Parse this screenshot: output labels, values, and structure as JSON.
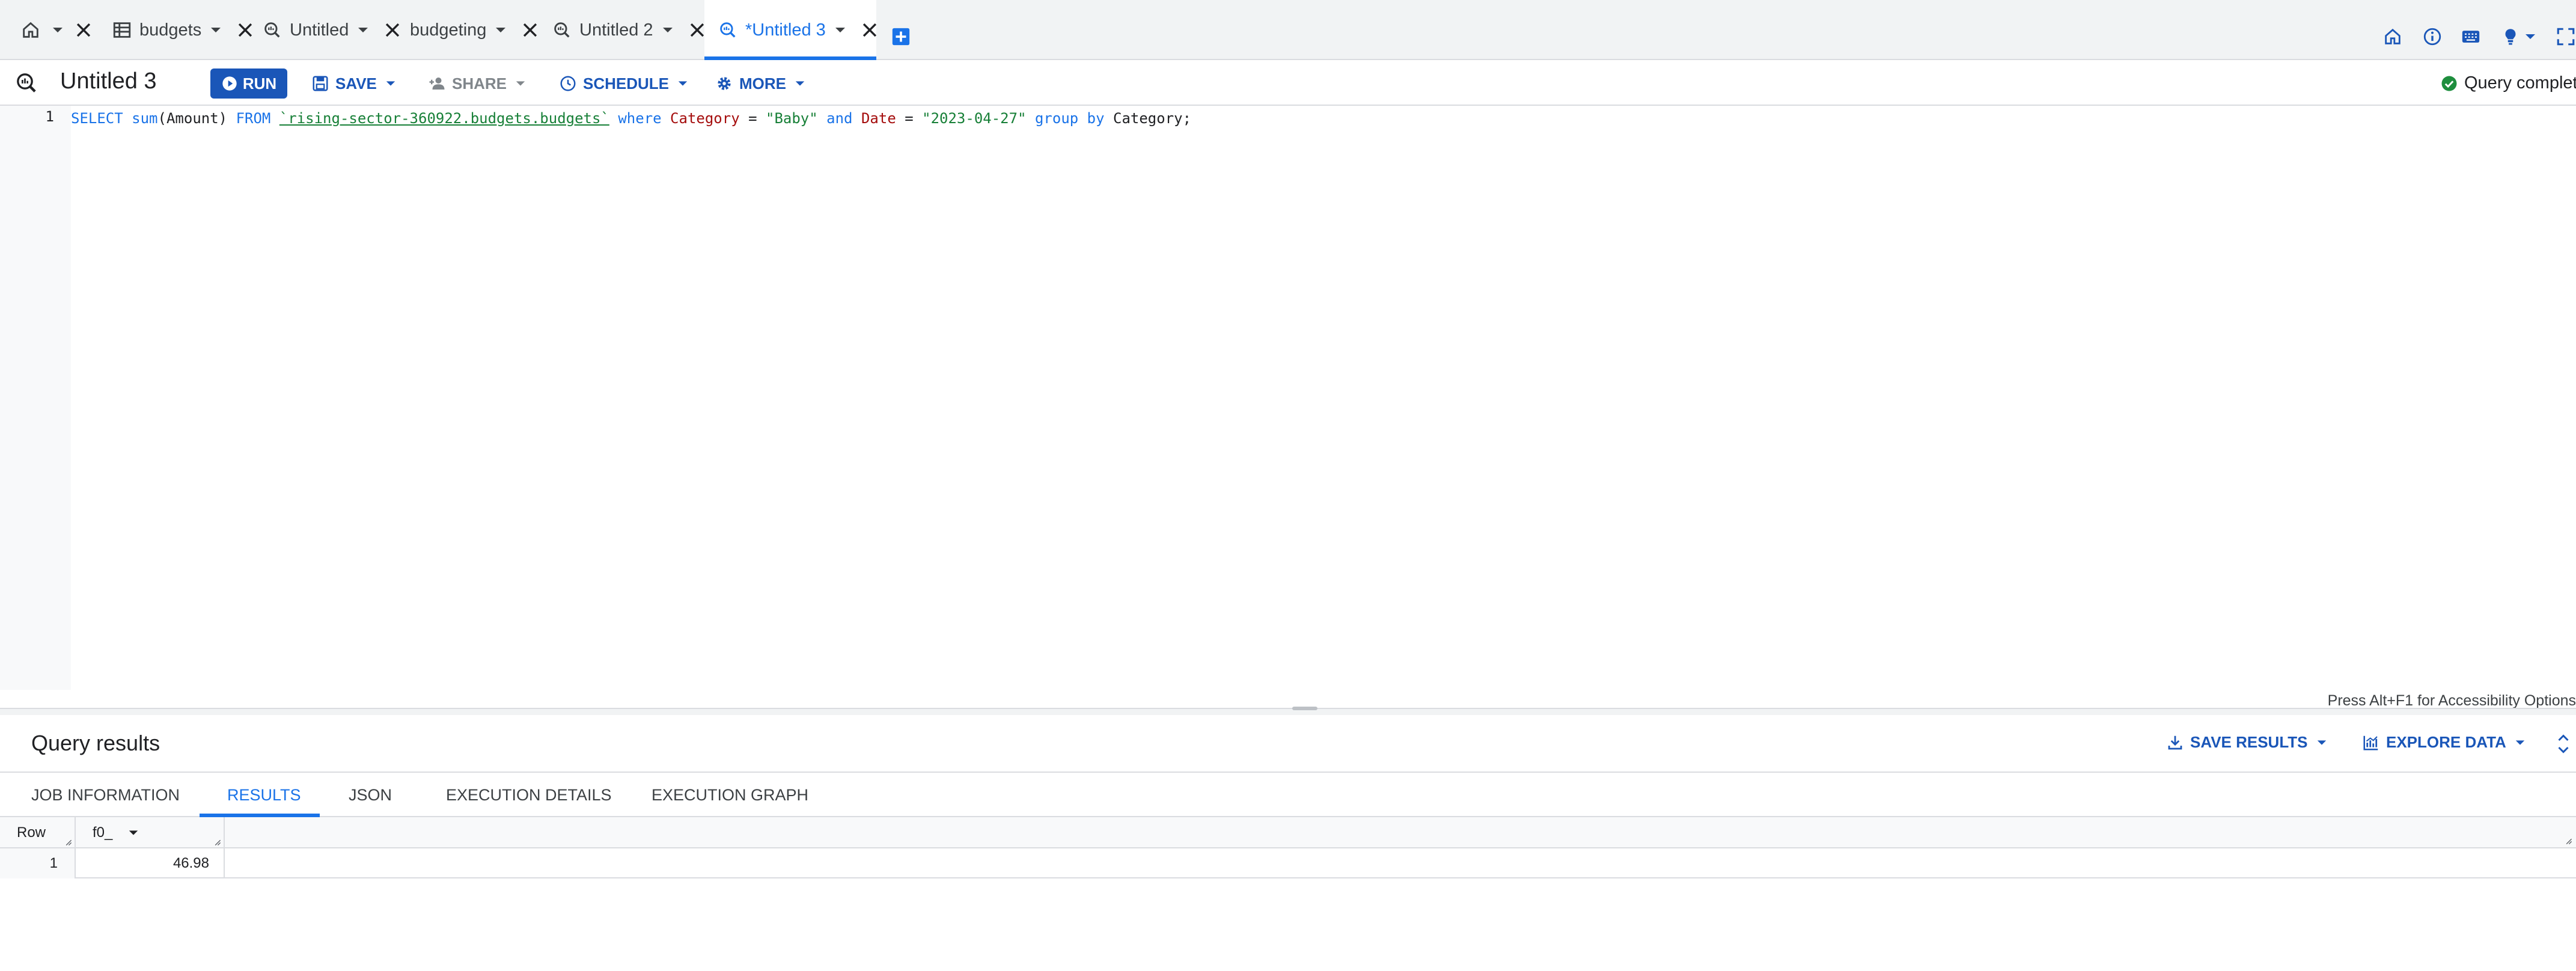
{
  "tabs": [
    {
      "label": "",
      "icon": "home-icon"
    },
    {
      "label": "budgets",
      "icon": "table-icon"
    },
    {
      "label": "Untitled",
      "icon": "query-icon"
    },
    {
      "label": "budgeting",
      "icon": ""
    },
    {
      "label": "Untitled 2",
      "icon": "query-icon"
    },
    {
      "label": "*Untitled 3",
      "icon": "query-icon",
      "active": true
    }
  ],
  "toolbar": {
    "title": "Untitled 3",
    "run_label": "RUN",
    "save_label": "SAVE",
    "share_label": "SHARE",
    "schedule_label": "SCHEDULE",
    "more_label": "MORE",
    "status_text": "Query completed"
  },
  "editor": {
    "line_number": "1",
    "query": {
      "t1": "SELECT",
      "t2": " ",
      "t3": "sum",
      "t4": "(Amount) ",
      "t5": "FROM",
      "t6": " ",
      "t7": "`rising-sector-360922.budgets.budgets`",
      "t8": " ",
      "t9": "where",
      "t10": " ",
      "t11": "Category",
      "t12": " = ",
      "t13": "\"Baby\"",
      "t14": " ",
      "t15": "and",
      "t16": " ",
      "t17": "Date",
      "t18": " = ",
      "t19": "\"2023-04-27\"",
      "t20": " ",
      "t21": "group by",
      "t22": " Category;"
    },
    "accessibility_hint": "Press Alt+F1 for Accessibility Options"
  },
  "results": {
    "title": "Query results",
    "save_results_label": "SAVE RESULTS",
    "explore_data_label": "EXPLORE DATA",
    "tabs": {
      "job_information": "JOB INFORMATION",
      "results": "RESULTS",
      "json": "JSON",
      "execution_details": "EXECUTION DETAILS",
      "execution_graph": "EXECUTION GRAPH"
    },
    "columns": {
      "row": "Row",
      "f0": "f0_"
    },
    "rows": [
      {
        "row": "1",
        "f0": "46.98"
      }
    ]
  },
  "colors": {
    "accent": "#1a73e8",
    "button": "#1a56b8",
    "success": "#1e8e3e"
  }
}
